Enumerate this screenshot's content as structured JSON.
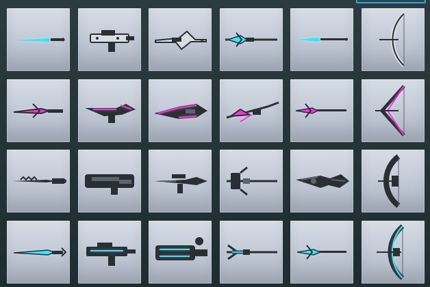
{
  "colors": {
    "accent_blue": "#2ea6e6",
    "cyan": "#37e6ff",
    "magenta": "#ff2fe2",
    "metal_dark": "#2a2f35",
    "metal_mid": "#5b6570",
    "metal_light": "#d9dee5"
  },
  "grid": {
    "rows": [
      {
        "items": [
          {
            "icon": "cyan-short-blade-icon"
          },
          {
            "icon": "white-assault-rifle-icon"
          },
          {
            "icon": "white-long-rifle-icon"
          },
          {
            "icon": "cyan-plasma-lance-icon"
          },
          {
            "icon": "cyan-spear-icon"
          },
          {
            "icon": "white-bow-icon"
          }
        ]
      },
      {
        "items": [
          {
            "icon": "magenta-blade-icon"
          },
          {
            "icon": "magenta-carbine-icon"
          },
          {
            "icon": "magenta-cannon-icon"
          },
          {
            "icon": "magenta-lance-icon"
          },
          {
            "icon": "magenta-spear-icon"
          },
          {
            "icon": "magenta-bow-icon"
          }
        ]
      },
      {
        "items": [
          {
            "icon": "black-serrated-blade-icon"
          },
          {
            "icon": "black-heavy-launcher-icon"
          },
          {
            "icon": "black-long-rifle-icon"
          },
          {
            "icon": "black-halberd-icon"
          },
          {
            "icon": "black-claw-weapon-icon"
          },
          {
            "icon": "black-bow-icon"
          }
        ]
      },
      {
        "items": [
          {
            "icon": "cyan-black-blade-icon"
          },
          {
            "icon": "cyan-black-assault-rifle-icon"
          },
          {
            "icon": "cyan-black-gatling-icon"
          },
          {
            "icon": "cyan-black-trident-icon"
          },
          {
            "icon": "cyan-black-spear-icon"
          },
          {
            "icon": "cyan-black-bow-icon"
          }
        ]
      }
    ]
  }
}
